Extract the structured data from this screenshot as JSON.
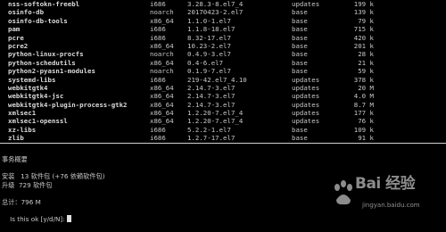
{
  "packages": [
    {
      "name": "nss-softokn-freebl",
      "arch": "i686",
      "version": "3.28.3-8.el7_4",
      "repo": "updates",
      "size": "199 k"
    },
    {
      "name": "osinfo-db",
      "arch": "noarch",
      "version": "20170423-2.el7",
      "repo": "base",
      "size": "139 k"
    },
    {
      "name": "osinfo-db-tools",
      "arch": "x86_64",
      "version": "1.1.0-1.el7",
      "repo": "base",
      "size": "79 k"
    },
    {
      "name": "pam",
      "arch": "i686",
      "version": "1.1.8-18.el7",
      "repo": "base",
      "size": "715 k"
    },
    {
      "name": "pcre",
      "arch": "i686",
      "version": "8.32-17.el7",
      "repo": "base",
      "size": "420 k"
    },
    {
      "name": "pcre2",
      "arch": "x86_64",
      "version": "10.23-2.el7",
      "repo": "base",
      "size": "201 k"
    },
    {
      "name": "python-linux-procfs",
      "arch": "noarch",
      "version": "0.4.9-3.el7",
      "repo": "base",
      "size": "28 k"
    },
    {
      "name": "python-schedutils",
      "arch": "x86_64",
      "version": "0.4-6.el7",
      "repo": "base",
      "size": "21 k"
    },
    {
      "name": "python2-pyasn1-modules",
      "arch": "noarch",
      "version": "0.1.9-7.el7",
      "repo": "base",
      "size": "59 k"
    },
    {
      "name": "systemd-libs",
      "arch": "i686",
      "version": "219-42.el7_4.10",
      "repo": "updates",
      "size": "378 k"
    },
    {
      "name": "webkitgtk4",
      "arch": "x86_64",
      "version": "2.14.7-3.el7",
      "repo": "updates",
      "size": "20 M"
    },
    {
      "name": "webkitgtk4-jsc",
      "arch": "x86_64",
      "version": "2.14.7-3.el7",
      "repo": "updates",
      "size": "4.0 M"
    },
    {
      "name": "webkitgtk4-plugin-process-gtk2",
      "arch": "x86_64",
      "version": "2.14.7-3.el7",
      "repo": "updates",
      "size": "8.7 M"
    },
    {
      "name": "xmlsec1",
      "arch": "x86_64",
      "version": "1.2.20-7.el7_4",
      "repo": "updates",
      "size": "177 k"
    },
    {
      "name": "xmlsec1-openssl",
      "arch": "x86_64",
      "version": "1.2.20-7.el7_4",
      "repo": "updates",
      "size": "76 k"
    },
    {
      "name": "xz-libs",
      "arch": "i686",
      "version": "5.2.2-1.el7",
      "repo": "base",
      "size": "109 k"
    },
    {
      "name": "zlib",
      "arch": "i686",
      "version": "1.2.7-17.el7",
      "repo": "base",
      "size": "91 k"
    }
  ],
  "summary": {
    "title": "事务概要",
    "install_line": "安装   13 软件包 (+76 依赖软件包)",
    "upgrade_line": "升级  729 软件包",
    "total_line": "总计：796 M",
    "prompt": "Is this ok [y/d/N]:"
  },
  "watermark": {
    "brand": "Bai 经验",
    "sub": "jingyan.baidu.com"
  }
}
